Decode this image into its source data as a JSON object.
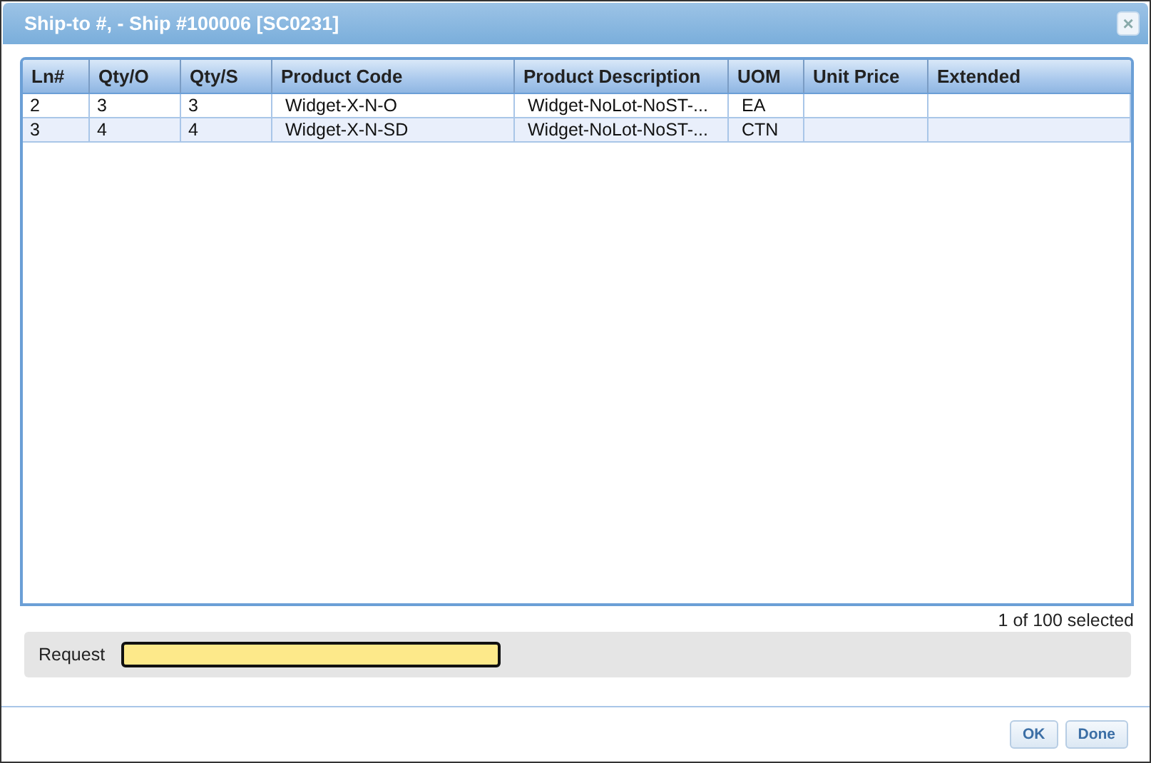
{
  "window": {
    "title": "Ship-to #, - Ship #100006 [SC0231]",
    "close": "×"
  },
  "table": {
    "columns": [
      "Ln#",
      "Qty/O",
      "Qty/S",
      "Product Code",
      "Product Description",
      "UOM",
      "Unit Price",
      "Extended"
    ],
    "rows": [
      {
        "selected": false,
        "cells": [
          "2",
          "3",
          "3",
          "Widget-X-N-O",
          "Widget-NoLot-NoST-...",
          "EA",
          "",
          ""
        ]
      },
      {
        "selected": true,
        "cells": [
          "3",
          "4",
          "4",
          "Widget-X-N-SD",
          "Widget-NoLot-NoST-...",
          "CTN",
          "",
          ""
        ]
      }
    ]
  },
  "selection_count": "1 of 100 selected",
  "request": {
    "label": "Request"
  },
  "buttons": [
    "OK",
    "Done"
  ]
}
